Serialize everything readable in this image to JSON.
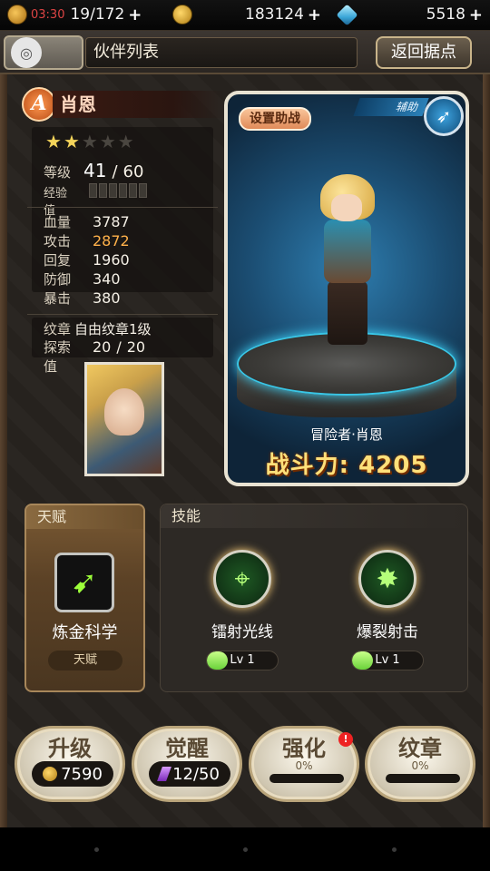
{
  "status": {
    "time": "03:30",
    "stamina": "19/172",
    "gold": "183124",
    "diamonds": "5518",
    "plus": "+"
  },
  "header": {
    "title": "伙伴列表",
    "back_label": "返回据点"
  },
  "hero": {
    "rank": "A",
    "name": "肖恩",
    "stars_filled": 2,
    "stars_total": 5,
    "level_label": "等级",
    "level": "41",
    "level_sep": "/",
    "level_max": "60",
    "exp_label": "经验值",
    "stats": [
      {
        "label": "血量",
        "value": "3787"
      },
      {
        "label": "攻击",
        "value": "2872"
      },
      {
        "label": "回复",
        "value": "1960"
      },
      {
        "label": "防御",
        "value": "340"
      },
      {
        "label": "暴击",
        "value": "380"
      }
    ],
    "emblem_label": "纹章",
    "emblem_value": "自由纹章1级",
    "explore_label": "探索值",
    "explore_value": "20",
    "explore_sep": "/",
    "explore_max": "20"
  },
  "card": {
    "set_assist_label": "设置助战",
    "role_label": "辅助",
    "character_title": "冒险者·肖恩",
    "power_label": "战斗力:",
    "power_value": "4205"
  },
  "talent": {
    "section_title": "天赋",
    "name": "炼金科学",
    "tag": "天赋",
    "icon": "crossbow-icon"
  },
  "skills": {
    "section_title": "技能",
    "items": [
      {
        "name": "镭射光线",
        "level": "Lv 1",
        "icon": "crosshair-icon"
      },
      {
        "name": "爆裂射击",
        "level": "Lv 1",
        "icon": "figure-burst-icon"
      }
    ]
  },
  "actions": [
    {
      "title": "升级",
      "value": "7590",
      "icon": "coin-icon"
    },
    {
      "title": "觉醒",
      "value": "12/50",
      "icon": "crystal-icon"
    },
    {
      "title": "强化",
      "percent": "0%",
      "badge": "!"
    },
    {
      "title": "纹章",
      "percent": "0%"
    }
  ]
}
